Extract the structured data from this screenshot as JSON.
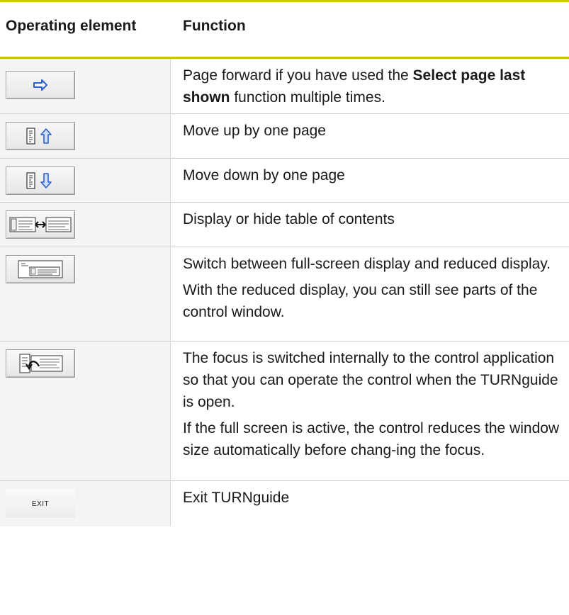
{
  "header": {
    "col1": "Operating element",
    "col2": "Function"
  },
  "rows": [
    {
      "icon": "arrow-right-icon",
      "segments": [
        {
          "t": "Page forward if you have used the ",
          "b": false
        },
        {
          "t": "Select page last shown",
          "b": true
        },
        {
          "t": " function multiple times.",
          "b": false
        }
      ],
      "extra": ""
    },
    {
      "icon": "page-up-icon",
      "text": "Move up by one page"
    },
    {
      "icon": "page-down-icon",
      "text": "Move down by one page"
    },
    {
      "icon": "toggle-toc-icon",
      "text": "Display or hide table of contents"
    },
    {
      "icon": "display-mode-icon",
      "text": "Switch between full-screen display and reduced display.",
      "text2": "With the reduced display, you can still see parts of the control window."
    },
    {
      "icon": "switch-focus-icon",
      "text": "The focus is switched internally to the control application so that you can operate the control when the TURNguide is open.",
      "text2": "If the full screen is active, the control reduces the window size automatically before chang-ing the focus."
    },
    {
      "icon": "exit-key",
      "button_label": "EXIT",
      "text": "Exit TURNguide"
    }
  ]
}
